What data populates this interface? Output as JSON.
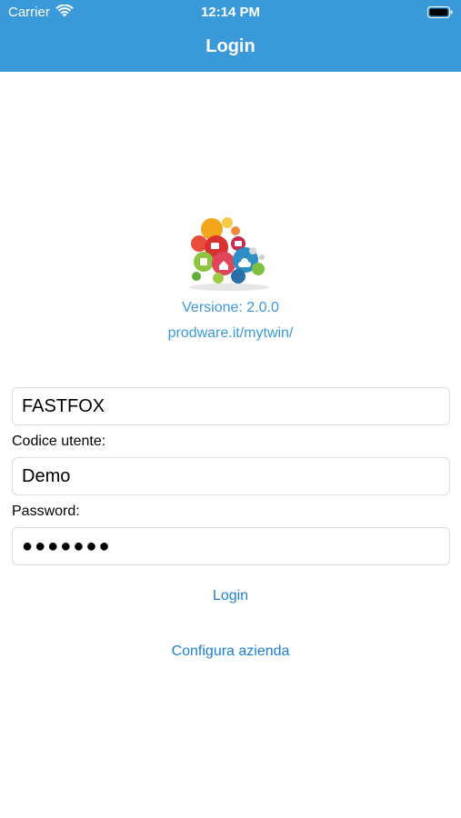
{
  "status_bar": {
    "carrier": "Carrier",
    "time": "12:14 PM"
  },
  "nav": {
    "title": "Login"
  },
  "app": {
    "version": "Versione: 2.0.0",
    "website": "prodware.it/mytwin/"
  },
  "form": {
    "company_value": "FASTFOX",
    "user_label": "Codice utente:",
    "user_value": "Demo",
    "password_label": "Password:",
    "password_value": "●●●●●●●"
  },
  "actions": {
    "login_label": "Login",
    "configure_label": "Configura azienda"
  },
  "colors": {
    "header": "#3a9ad9",
    "link": "#3a9ad9",
    "button": "#1a7fd4"
  }
}
